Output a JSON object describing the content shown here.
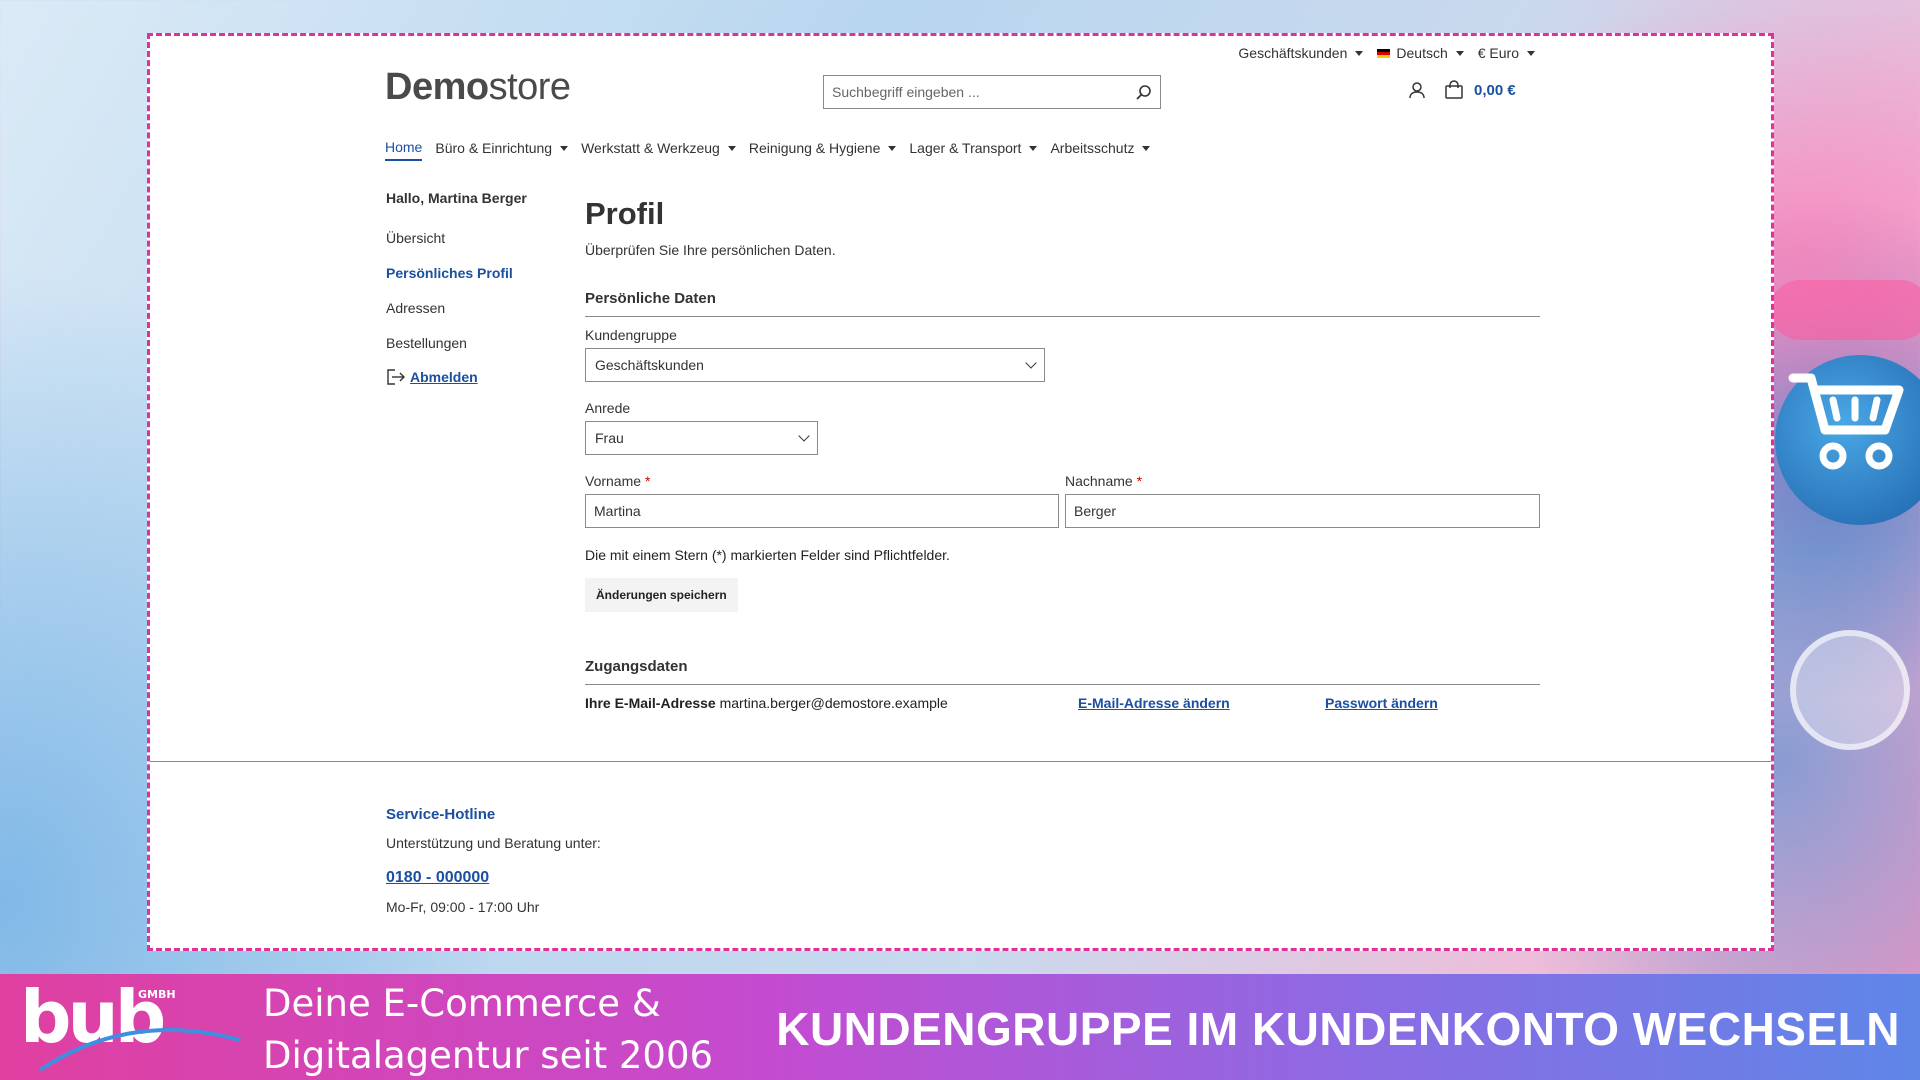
{
  "topbar": {
    "customer_group": "Geschäftskunden",
    "language": "Deutsch",
    "currency": "€ Euro"
  },
  "header": {
    "logo_bold": "Demo",
    "logo_light": "store",
    "search_placeholder": "Suchbegriff eingeben ...",
    "cart_total": "0,00 €"
  },
  "nav": [
    {
      "label": "Home",
      "active": true,
      "dropdown": false
    },
    {
      "label": "Büro & Einrichtung",
      "dropdown": true
    },
    {
      "label": "Werkstatt & Werkzeug",
      "dropdown": true
    },
    {
      "label": "Reinigung & Hygiene",
      "dropdown": true
    },
    {
      "label": "Lager & Transport",
      "dropdown": true
    },
    {
      "label": "Arbeitsschutz",
      "dropdown": true
    }
  ],
  "sidebar": {
    "greeting": "Hallo, Martina Berger",
    "items": [
      {
        "label": "Übersicht"
      },
      {
        "label": "Persönliches Profil",
        "active": true
      },
      {
        "label": "Adressen"
      },
      {
        "label": "Bestellungen"
      }
    ],
    "logout": "Abmelden"
  },
  "profile": {
    "title": "Profil",
    "subtitle": "Überprüfen Sie Ihre persönlichen Daten.",
    "section_personal": "Persönliche Daten",
    "customer_group_label": "Kundengruppe",
    "customer_group_value": "Geschäftskunden",
    "salutation_label": "Anrede",
    "salutation_value": "Frau",
    "firstname_label": "Vorname",
    "firstname_value": "Martina",
    "lastname_label": "Nachname",
    "lastname_value": "Berger",
    "required_mark": "*",
    "required_note": "Die mit einem Stern (*) markierten Felder sind Pflichtfelder.",
    "save_button": "Änderungen speichern",
    "section_access": "Zugangsdaten",
    "email_label": "Ihre E-Mail-Adresse",
    "email_value": "martina.berger@demostore.example",
    "change_email": "E-Mail-Adresse ändern",
    "change_password": "Passwort ändern"
  },
  "footer": {
    "title": "Service-Hotline",
    "support_text": "Unterstützung und Beratung unter:",
    "phone": "0180 - 000000",
    "hours": "Mo-Fr, 09:00 - 17:00 Uhr"
  },
  "banner": {
    "brand": "bub",
    "brand_suffix": "GMBH",
    "tagline_line1": "Deine E-Commerce &",
    "tagline_line2": "Digitalagentur seit 2006",
    "headline": "KUNDENGRUPPE IM KUNDENKONTO WECHSELN"
  },
  "colors": {
    "accent": "#1b4fa0",
    "frame_border": "#e0309a",
    "required": "#cc0000"
  }
}
